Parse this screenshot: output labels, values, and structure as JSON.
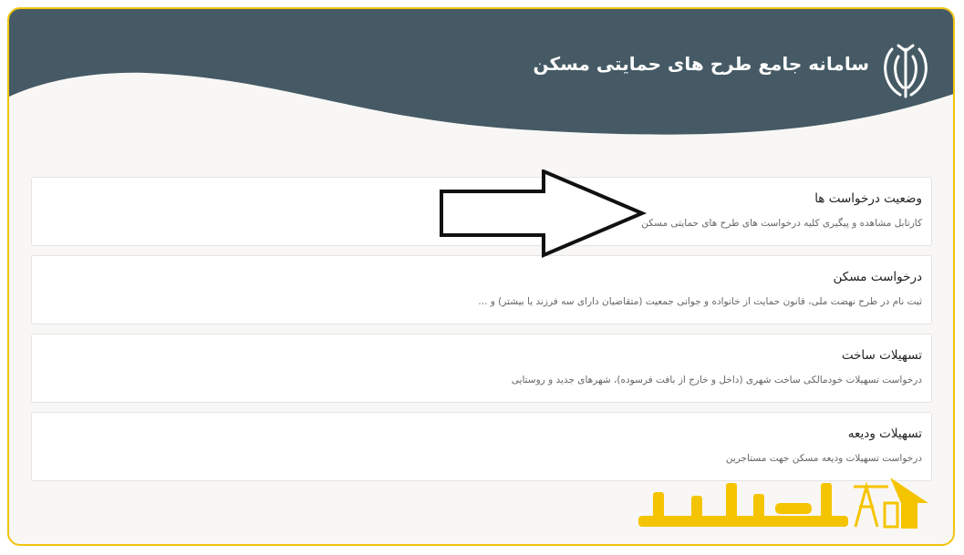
{
  "header": {
    "app_title": "سامانه جامع طرح های حمایتی مسکن",
    "background_color": "#455a64",
    "emblem_icon": "iran-emblem-icon"
  },
  "services": [
    {
      "title": "وضعیت درخواست ها",
      "description": "کارتابل مشاهده و پیگیری کلیه درخواست های طرح های حمایتی مسکن"
    },
    {
      "title": "درخواست مسکن",
      "description": "ثبت نام در طرح نهضت ملی، قانون حمایت از خانواده و جوانی جمعیت (متقاضیان دارای سه فرزند یا بیشتر) و ..."
    },
    {
      "title": "تسهیلات ساخت",
      "description": "درخواست تسهیلات خودمالکی ساخت شهری (داخل و خارج از بافت فرسوده)، شهرهای جدید و روستایی"
    },
    {
      "title": "تسهیلات ودیعه",
      "description": "درخواست تسهیلات ودیعه مسکن جهت مستاجرین"
    }
  ],
  "annotation": {
    "arrow_icon": "pointer-arrow-icon"
  },
  "watermark": {
    "logo_icon": "amlak-logo-icon",
    "color": "#f5c400"
  },
  "frame": {
    "border_color": "#f1c40f"
  }
}
